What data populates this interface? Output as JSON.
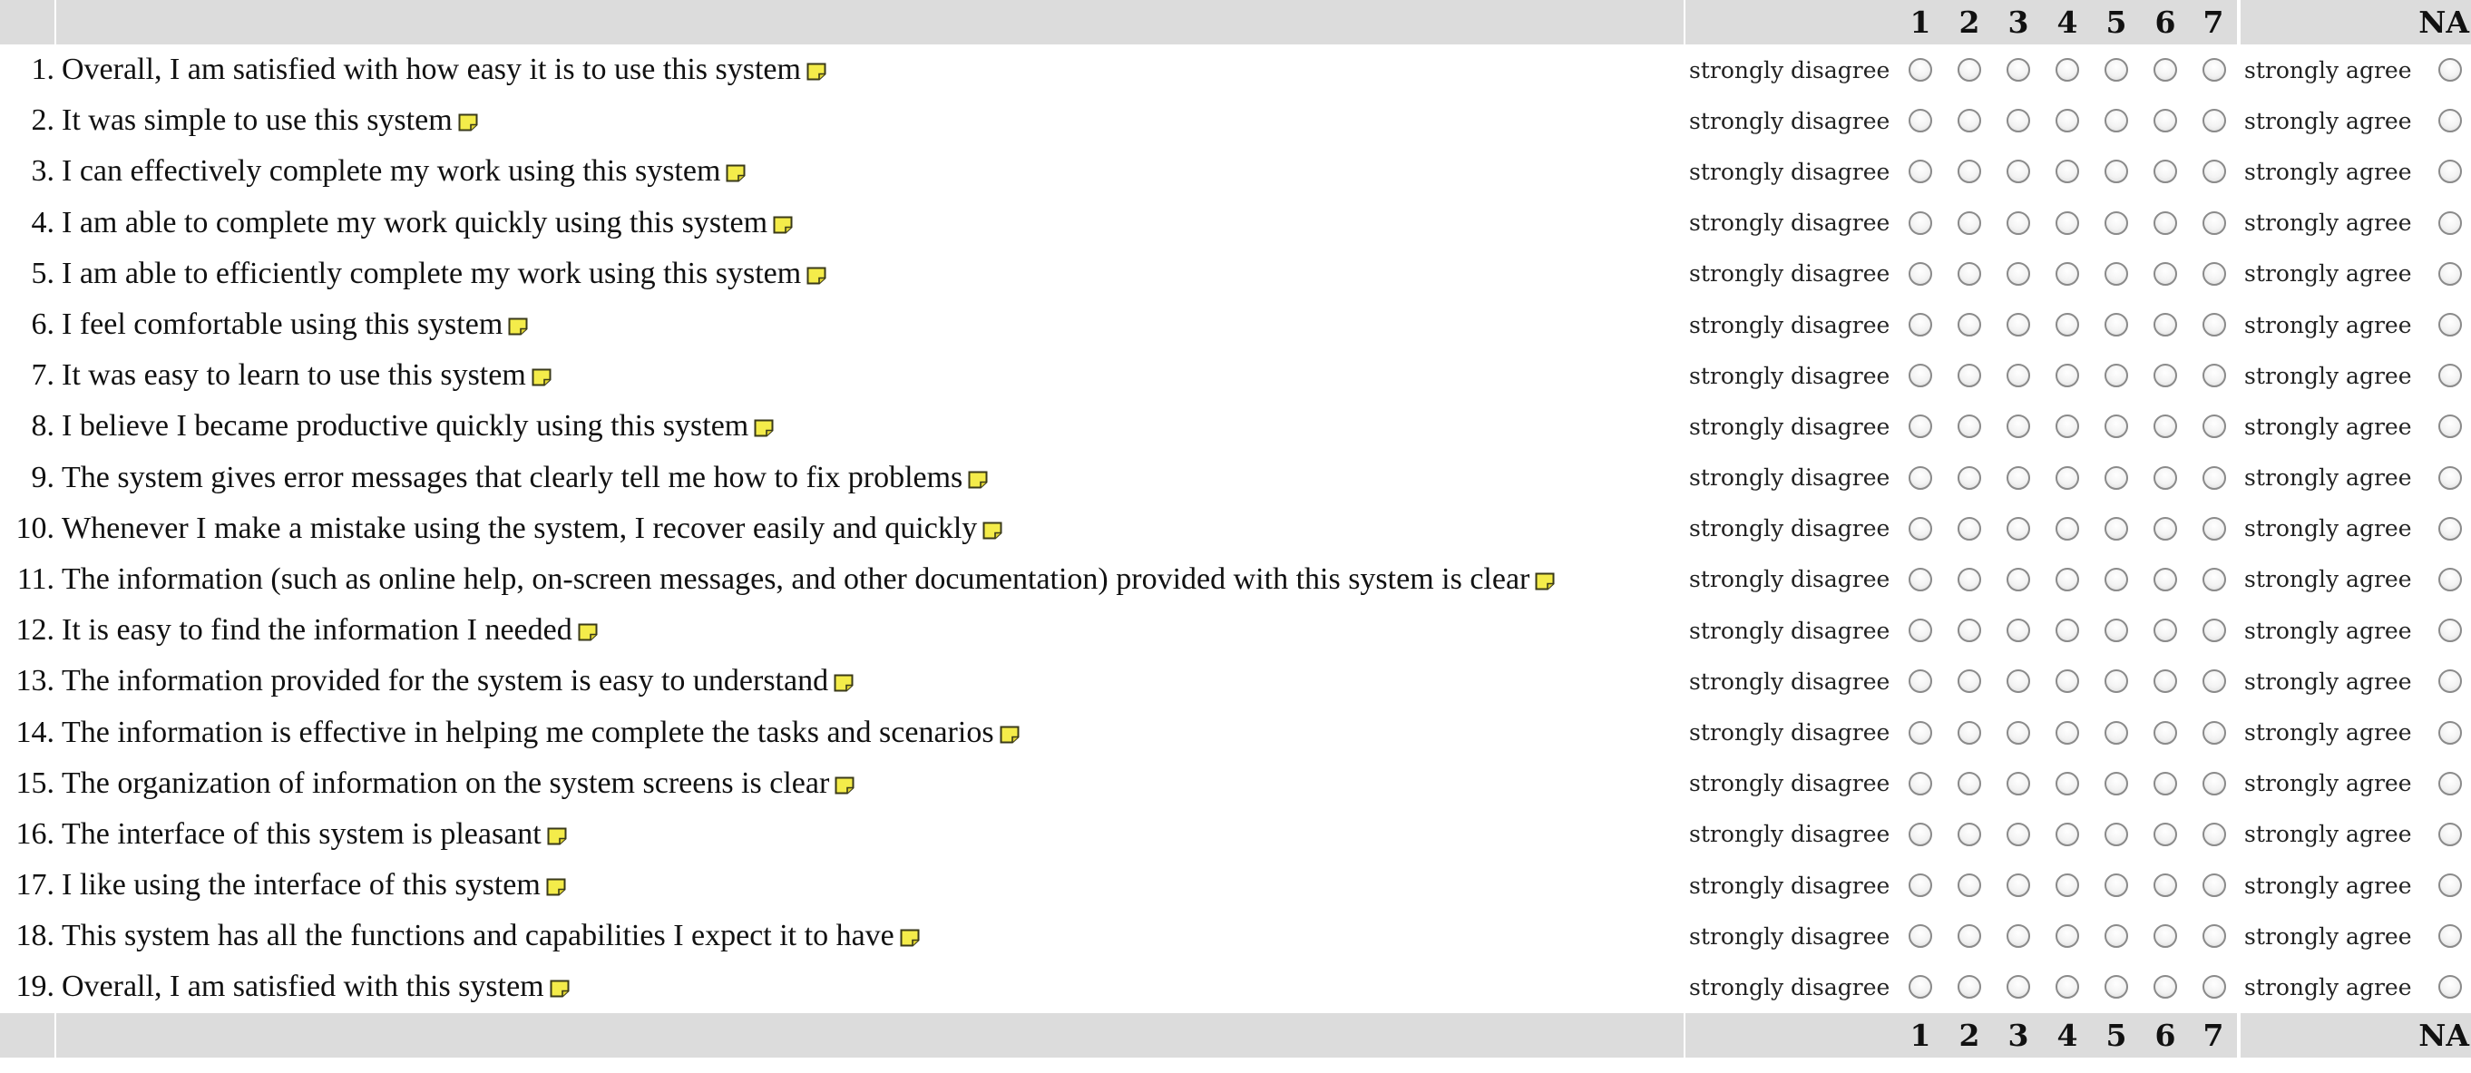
{
  "scale": {
    "points": [
      "1",
      "2",
      "3",
      "4",
      "5",
      "6",
      "7"
    ],
    "na_label": "NA",
    "low_anchor": "strongly disagree",
    "high_anchor": "strongly agree"
  },
  "items": [
    {
      "num": "1.",
      "text": "Overall, I am satisfied with how easy it is to use this system"
    },
    {
      "num": "2.",
      "text": "It was simple to use this system"
    },
    {
      "num": "3.",
      "text": "I can effectively complete my work using this system"
    },
    {
      "num": "4.",
      "text": "I am able to complete my work quickly using this system"
    },
    {
      "num": "5.",
      "text": "I am able to efficiently complete my work using this system"
    },
    {
      "num": "6.",
      "text": "I feel comfortable using this system"
    },
    {
      "num": "7.",
      "text": "It was easy to learn to use this system"
    },
    {
      "num": "8.",
      "text": "I believe I became productive quickly using this system"
    },
    {
      "num": "9.",
      "text": "The system gives error messages that clearly tell me how to fix problems"
    },
    {
      "num": "10.",
      "text": "Whenever I make a mistake using the system, I recover easily and quickly"
    },
    {
      "num": "11.",
      "text": "The information (such as online help, on-screen messages, and other documentation) provided with this system is clear"
    },
    {
      "num": "12.",
      "text": "It is easy to find the information I needed"
    },
    {
      "num": "13.",
      "text": "The information provided for the system is easy to understand"
    },
    {
      "num": "14.",
      "text": "The information is effective in helping me complete the tasks and scenarios"
    },
    {
      "num": "15.",
      "text": "The organization of information on the system screens is clear"
    },
    {
      "num": "16.",
      "text": "The interface of this system is pleasant"
    },
    {
      "num": "17.",
      "text": "I like using the interface of this system"
    },
    {
      "num": "18.",
      "text": "This system has all the functions and capabilities I expect it to have"
    },
    {
      "num": "19.",
      "text": "Overall, I am satisfied with this system"
    }
  ],
  "icons": {
    "note": "comment-note-icon",
    "option": "radio-button"
  },
  "colors": {
    "header_band": "#dcdcdc",
    "note_fill": "#f4ec4a",
    "note_stroke": "#3a3a1a"
  }
}
